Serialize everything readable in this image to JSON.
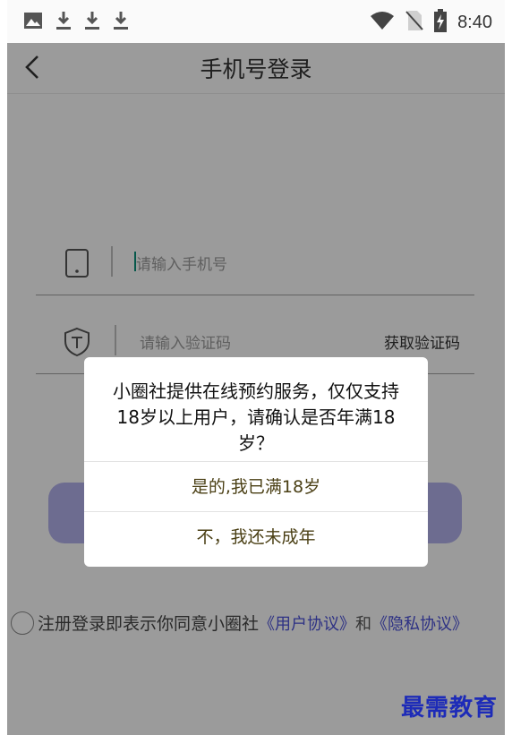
{
  "status_bar": {
    "left_icons": [
      "image-icon",
      "download-icon",
      "download-icon",
      "download-icon"
    ],
    "right_icons": [
      "wifi-icon",
      "no-sim-icon",
      "battery-charging-icon"
    ],
    "time": "8:40"
  },
  "nav": {
    "back_icon": "chevron-left-icon",
    "title": "手机号登录"
  },
  "form": {
    "phone": {
      "icon": "phone-icon",
      "placeholder": "请输入手机号"
    },
    "code": {
      "icon": "shield-icon",
      "placeholder": "请输入验证码",
      "get_code": "获取验证码"
    },
    "login_button_color": "#b0afe8"
  },
  "agreement": {
    "prefix": "注册登录即表示你同意小圈社",
    "user_agreement": "《用户协议》",
    "and": "和",
    "privacy_policy": "《隐私协议》"
  },
  "dialog": {
    "message": "小圈社提供在线预约服务，仅仅支持18岁以上用户，请确认是否年满18岁？",
    "confirm": "是的,我已满18岁",
    "deny": "不，我还未成年"
  },
  "watermark": "最需教育",
  "colors": {
    "link": "#4a4fd6",
    "cursor": "#0a8f7a",
    "watermark": "#1d2bb8"
  }
}
